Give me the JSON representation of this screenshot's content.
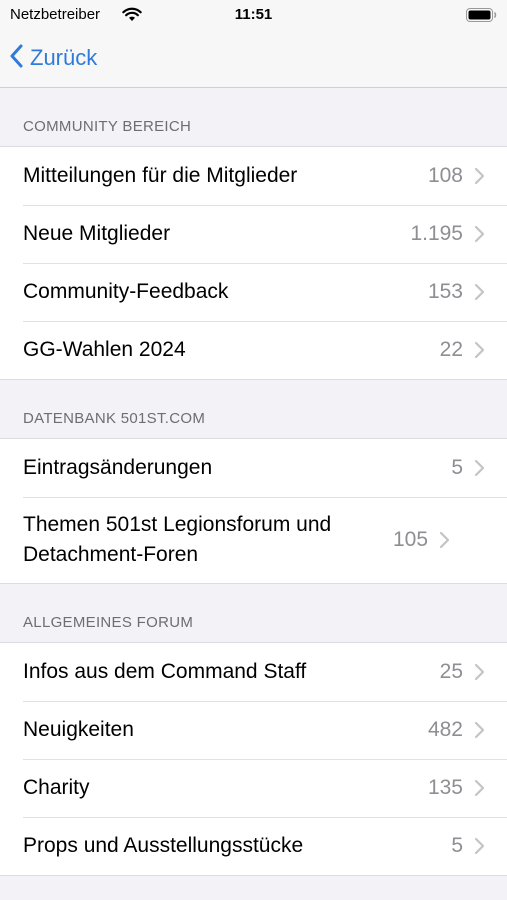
{
  "status": {
    "carrier": "Netzbetreiber",
    "time": "11:51"
  },
  "nav": {
    "back_label": "Zurück"
  },
  "sections": [
    {
      "header": "COMMUNITY BEREICH",
      "items": [
        {
          "label": "Mitteilungen für die Mitglieder",
          "count": "108"
        },
        {
          "label": "Neue Mitglieder",
          "count": "1.195"
        },
        {
          "label": "Community-Feedback",
          "count": "153"
        },
        {
          "label": "GG-Wahlen 2024",
          "count": "22"
        }
      ]
    },
    {
      "header": "DATENBANK 501ST.COM",
      "items": [
        {
          "label": "Eintragsänderungen",
          "count": "5"
        },
        {
          "label": "Themen 501st Legionsforum und Detachment-Foren",
          "count": "105"
        }
      ]
    },
    {
      "header": "ALLGEMEINES FORUM",
      "items": [
        {
          "label": "Infos aus dem Command Staff",
          "count": "25"
        },
        {
          "label": "Neuigkeiten",
          "count": "482"
        },
        {
          "label": "Charity",
          "count": "135"
        },
        {
          "label": "Props und Ausstellungsstücke",
          "count": "5"
        }
      ]
    }
  ],
  "colors": {
    "accent": "#2f7bd9",
    "background": "#f2f2f7",
    "secondary_text": "#8e8e93"
  },
  "icons": [
    "wifi-icon",
    "battery-icon",
    "chevron-left-icon",
    "chevron-right-icon"
  ]
}
